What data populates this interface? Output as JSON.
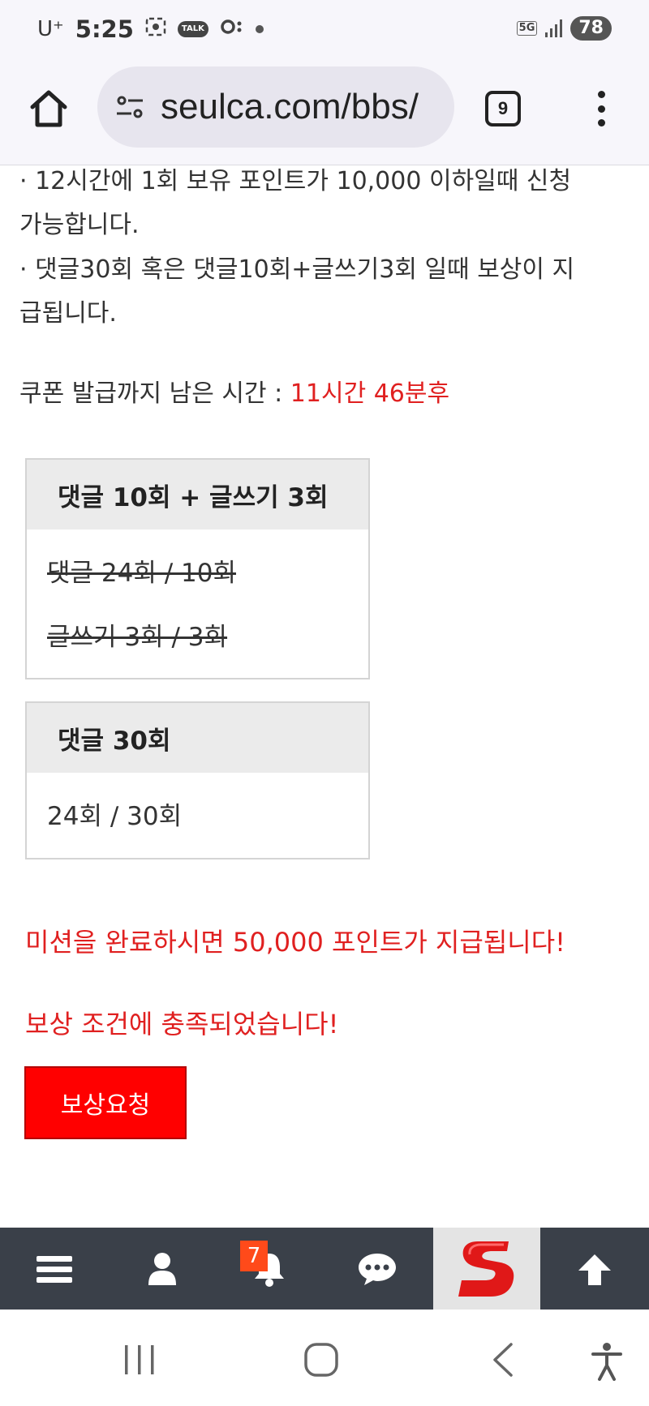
{
  "status_bar": {
    "carrier": "U⁺",
    "time": "5:25",
    "network": "5G",
    "battery": "78"
  },
  "browser": {
    "url": "seulca.com/bbs/",
    "tab_count": "9"
  },
  "rules": {
    "line1": "· 12시간에 1회 보유 포인트가 10,000 이하일때 신청",
    "line2": "가능합니다.",
    "line3": "· 댓글30회 혹은 댓글10회+글쓰기3회 일때 보상이 지",
    "line4": "급됩니다."
  },
  "timer": {
    "label": "쿠폰 발급까지 남은 시간 : ",
    "remaining": "11시간 46분후"
  },
  "mission_combo": {
    "title": "댓글 10회 + 글쓰기 3회",
    "comments_progress": "댓글 24회 / 10회",
    "posts_progress": "글쓰기 3회 / 3회"
  },
  "mission_comments": {
    "title": "댓글 30회",
    "progress": "24회 / 30회"
  },
  "notices": {
    "reward_info": "미션을 완료하시면 50,000 포인트가 지급됩니다!",
    "condition_met": "보상 조건에 충족되었습니다!"
  },
  "reward_button": {
    "label": "보상요청"
  },
  "bottom_nav": {
    "notification_count": "7"
  },
  "colors": {
    "accent_red": "#ff0000",
    "notice_red": "#e02020",
    "nav_bg": "#3a4049",
    "badge_orange": "#ff4a1a"
  }
}
